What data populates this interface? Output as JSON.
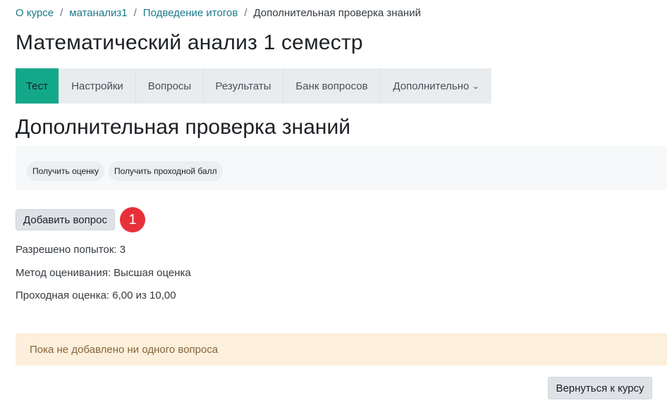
{
  "breadcrumb": {
    "items": [
      "О курсе",
      "матанализ1",
      "Подведение итогов"
    ],
    "current": "Дополнительная проверка знаний",
    "separator": "/"
  },
  "course_title": "Математический анализ 1 семестр",
  "tabs": [
    {
      "label": "Тест",
      "active": true
    },
    {
      "label": "Настройки",
      "active": false
    },
    {
      "label": "Вопросы",
      "active": false
    },
    {
      "label": "Результаты",
      "active": false
    },
    {
      "label": "Банк вопросов",
      "active": false
    },
    {
      "label": "Дополнительно",
      "active": false,
      "icon": "chevron-down-icon"
    }
  ],
  "quiz_title": "Дополнительная проверка знаний",
  "grade_buttons": {
    "get_grade": "Получить оценку",
    "get_pass_grade": "Получить проходной балл"
  },
  "add_question": {
    "label": "Добавить вопрос",
    "badge": "1"
  },
  "info": {
    "attempts": "Разрешено попыток: 3",
    "method": "Метод оценивания: Высшая оценка",
    "pass_grade": "Проходная оценка: 6,00 из 10,00"
  },
  "alert": "Пока не добавлено ни одного вопроса",
  "back_button": "Вернуться к курсу",
  "colors": {
    "accent": "#14a88a",
    "link": "#1a7a8a",
    "badge": "#e8303a",
    "alert_bg": "#fcefdc"
  }
}
